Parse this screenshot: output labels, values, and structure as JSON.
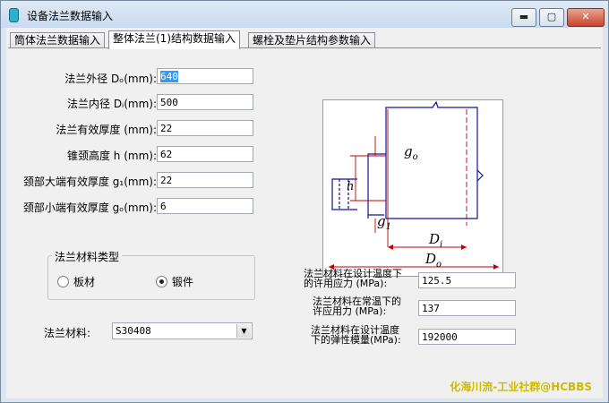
{
  "window": {
    "title": "设备法兰数据输入",
    "minimize": "▬",
    "maximize": "▢",
    "close": "✕"
  },
  "tabs": [
    {
      "label": "筒体法兰数据输入"
    },
    {
      "label": "整体法兰(1)结构数据输入"
    },
    {
      "label": "螺栓及垫片结构参数输入"
    }
  ],
  "fields": [
    {
      "label": "法兰外径 Dₒ(mm):",
      "value": "640"
    },
    {
      "label": "法兰内径 Dᵢ(mm):",
      "value": "500"
    },
    {
      "label": "法兰有效厚度 (mm):",
      "value": "22"
    },
    {
      "label": "锥颈高度 h (mm):",
      "value": "62"
    },
    {
      "label": "颈部大端有效厚度 g₁(mm):",
      "value": "22"
    },
    {
      "label": "颈部小端有效厚度 gₒ(mm):",
      "value": "6"
    }
  ],
  "material_type": {
    "legend": "法兰材料类型",
    "option1": "板材",
    "option2": "锻件",
    "selected": "锻件"
  },
  "material": {
    "label": "法兰材料:",
    "value": "S30408"
  },
  "stress": [
    {
      "line1": "法兰材料在设计温度下",
      "line2": "的许用应力 (MPa):",
      "value": "125.5"
    },
    {
      "line1": "法兰材料在常温下的",
      "line2": "许应用力 (MPa):",
      "value": "137"
    },
    {
      "line1": "法兰材料在设计温度",
      "line2": "下的弹性模量(MPa):",
      "value": "192000"
    }
  ],
  "diagram": {
    "g0": "g",
    "g0_sub": "o",
    "g1": "g",
    "g1_sub": "1",
    "h": "h",
    "Di": "D",
    "Di_sub": "i",
    "Do": "D",
    "Do_sub": "o"
  },
  "watermark": "化海川流-工业社群@HCBBS"
}
